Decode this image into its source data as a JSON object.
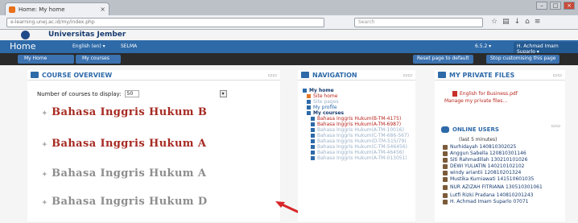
{
  "browser": {
    "tab_title": "Home: My home",
    "tab_close": "×",
    "url": "e-learning.unej.ac.id/my/index.php",
    "search_placeholder": "Search"
  },
  "site": {
    "name": "Universitas Jember"
  },
  "navbar": {
    "home": "Home",
    "language": "English (en) ▾",
    "site_short": "SELMA",
    "user_right": "6.5.2 ▾",
    "user_name": "H. Achmad Imam Suparlo ▾"
  },
  "breadcrumb": [
    "My Home",
    "My courses"
  ],
  "page_buttons": [
    "Reset page to default",
    "Stop customising this page"
  ],
  "overview": {
    "title": "COURSE OVERVIEW",
    "display_label": "Number of courses to display:",
    "display_value": "50",
    "courses": [
      {
        "name": "Bahasa Inggris Hukum B",
        "style": "red"
      },
      {
        "name": "Bahasa Inggris Hukum A",
        "style": "red"
      },
      {
        "name": "Bahasa Inggris Hukum A",
        "style": "grey"
      },
      {
        "name": "Bahasa Inggris Hukum D",
        "style": "grey"
      }
    ]
  },
  "navigation": {
    "title": "NAVIGATION",
    "items": [
      {
        "label": "My home",
        "type": "bold"
      },
      {
        "label": "Site home",
        "type": "red"
      },
      {
        "label": "Site pages",
        "type": "faded"
      },
      {
        "label": "My profile",
        "type": "normal"
      },
      {
        "label": "My courses",
        "type": "bold"
      },
      {
        "label": "Bahasa Inggris Hukum(B-TM-4175)",
        "type": "red"
      },
      {
        "label": "Bahasa Inggris Hukum(A-TM-6987)",
        "type": "red"
      },
      {
        "label": "Bahasa Inggris Hukum(A-TM-10016)",
        "type": "faded"
      },
      {
        "label": "Bahasa Inggris Hukum(C-TM-686-567)",
        "type": "faded"
      },
      {
        "label": "Bahasa Inggris Hukum(D-TM-515/79)",
        "type": "faded"
      },
      {
        "label": "Bahasa Inggris Hukum(C-TM-546456)",
        "type": "faded"
      },
      {
        "label": "Bahasa Inggris Hukum(A-TM-46456)",
        "type": "faded"
      },
      {
        "label": "Bahasa Inggris Hukum(A-TM-013051)",
        "type": "faded"
      }
    ]
  },
  "private_files": {
    "title": "MY PRIVATE FILES",
    "file": "English for Business.pdf",
    "manage": "Manage my private files..."
  },
  "online_users": {
    "title": "ONLINE USERS",
    "period": "(last 5 minutes)",
    "users": [
      "Nurhidayah 140810302025",
      "Anggun Sabella 120810301146",
      "Siti Rahmadillah 130210101026",
      "DEWI YULIATIN 140210102102",
      "windy ariantii 120810201324",
      "Mustika Kurniawati 141510601035",
      "NUR AZIZAH FITRIANA 130510301061",
      "Lutfi Rizki Pradana 140810201243",
      "H. Achmad Imam Suparlo 07071"
    ]
  },
  "colors": {
    "navbar": "#2e6aa8",
    "course_red": "#a62a22",
    "course_grey": "#8d8d8d",
    "annotation_arrow": "#d8262a"
  }
}
